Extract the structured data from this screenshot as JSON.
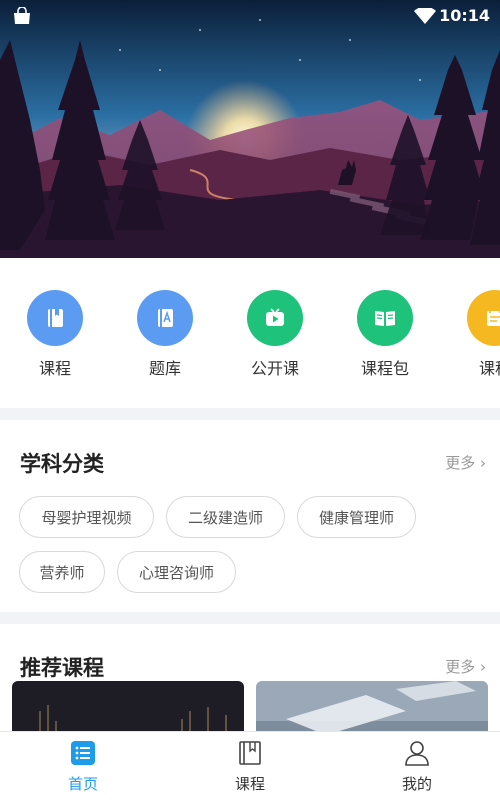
{
  "status_bar": {
    "time": "10:14",
    "icons": [
      "shopping-bag-icon",
      "wifi-icon"
    ]
  },
  "hero": {
    "image": "landscape-banner",
    "colors": {
      "sky_top": "#0d2a48",
      "sky_mid": "#2a6aa0",
      "glow": "#f6c98a",
      "hills": "#7a3a6a"
    }
  },
  "categories": [
    {
      "label": "课程",
      "icon": "book-icon",
      "color": "#5b9cf2"
    },
    {
      "label": "题库",
      "icon": "question-bank-icon",
      "color": "#5b9cf2"
    },
    {
      "label": "公开课",
      "icon": "tv-play-icon",
      "color": "#1fc27a"
    },
    {
      "label": "课程包",
      "icon": "open-book-icon",
      "color": "#1fc27a"
    },
    {
      "label": "课程",
      "icon": "course-card-icon",
      "color": "#f5b820"
    }
  ],
  "subjects": {
    "title": "学科分类",
    "more": "更多",
    "tags": [
      "母婴护理视频",
      "二级建造师",
      "健康管理师",
      "营养师",
      "心理咨询师"
    ]
  },
  "recommended": {
    "title": "推荐课程",
    "more": "更多",
    "cards": [
      {
        "image": "night-harbor-thumbnail"
      },
      {
        "image": "light-window-thumbnail"
      }
    ]
  },
  "bottom_nav": {
    "items": [
      {
        "label": "首页",
        "icon": "home-list-icon",
        "active": true
      },
      {
        "label": "课程",
        "icon": "book-outline-icon",
        "active": false
      },
      {
        "label": "我的",
        "icon": "person-icon",
        "active": false
      }
    ],
    "active_color": "#1e9be9"
  }
}
